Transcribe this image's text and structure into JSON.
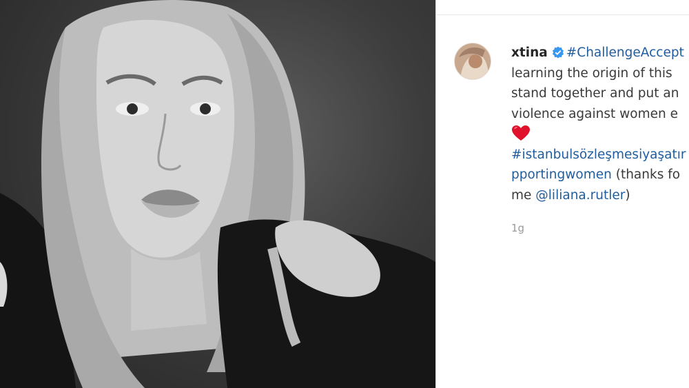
{
  "post": {
    "username": "xtina",
    "hashtag_title": "#ChallengeAccept",
    "caption_line_2": "learning the origin of this",
    "caption_line_3": "stand together and put an",
    "caption_line_4": "violence against women e",
    "hashtag_line": "#istanbulsözleşmesiyaşatır",
    "line_7_tag": "pporting",
    "line_7_tag_2": "women",
    "line_7_rest": " (thanks fo",
    "line_8_pre": "me ",
    "mention": "@liliana.rutler",
    "line_8_post": ")",
    "timestamp": "1g"
  },
  "icons": {
    "verified": "verified-badge-icon",
    "heart": "red-heart-emoji-icon"
  },
  "colors": {
    "link": "#1f5d9e",
    "verified": "#3897f0",
    "heart": "#e0112b",
    "text": "#3a3a3a"
  }
}
